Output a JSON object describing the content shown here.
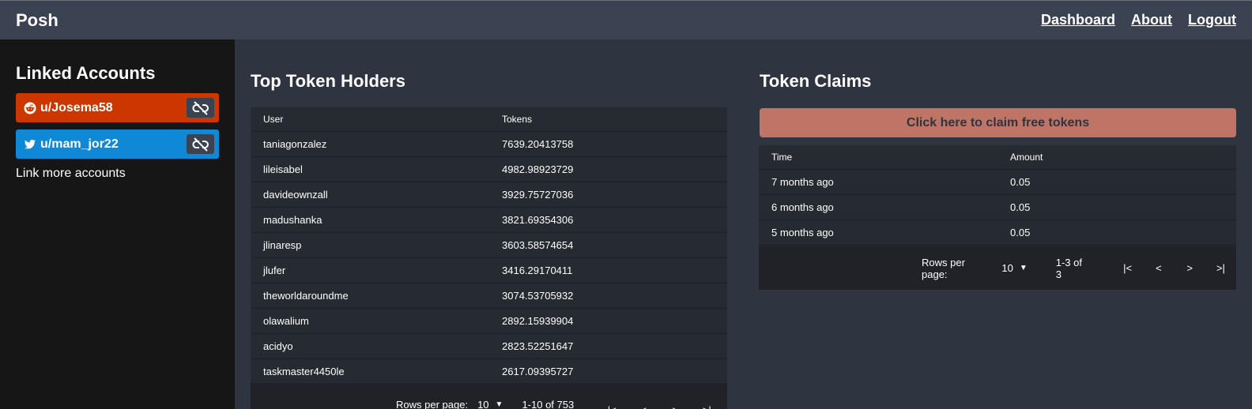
{
  "app": {
    "title": "Posh"
  },
  "nav": {
    "dashboard": "Dashboard",
    "about": "About",
    "logout": "Logout"
  },
  "sidebar": {
    "heading": "Linked Accounts",
    "accounts": [
      {
        "service": "reddit",
        "name": "u/Josema58",
        "color": "#cc3700"
      },
      {
        "service": "twitter",
        "name": "u/mam_jor22",
        "color": "#0f89d6"
      }
    ],
    "link_more": "Link more accounts"
  },
  "holders": {
    "title": "Top Token Holders",
    "columns": [
      "User",
      "Tokens"
    ],
    "rows": [
      [
        "taniagonzalez",
        "7639.20413758"
      ],
      [
        "lileisabel",
        "4982.98923729"
      ],
      [
        "davideownzall",
        "3929.75727036"
      ],
      [
        "madushanka",
        "3821.69354306"
      ],
      [
        "jlinaresp",
        "3603.58574654"
      ],
      [
        "jlufer",
        "3416.29170411"
      ],
      [
        "theworldaroundme",
        "3074.53705932"
      ],
      [
        "olawalium",
        "2892.15939904"
      ],
      [
        "acidyo",
        "2823.52251647"
      ],
      [
        "taskmaster4450le",
        "2617.09395727"
      ]
    ],
    "pager": {
      "rows_label": "Rows per page:",
      "rows_value": "10",
      "range": "1-10 of 753"
    }
  },
  "claims": {
    "title": "Token Claims",
    "claim_button": "Click here to claim free tokens",
    "columns": [
      "Time",
      "Amount"
    ],
    "rows": [
      [
        "7 months ago",
        "0.05"
      ],
      [
        "6 months ago",
        "0.05"
      ],
      [
        "5 months ago",
        "0.05"
      ]
    ],
    "pager": {
      "rows_label": "Rows per page:",
      "rows_value": "10",
      "range": "1-3 of 3"
    }
  },
  "icons": {
    "reddit": "reddit-icon",
    "twitter": "twitter-icon",
    "unlink": "unlink-icon",
    "first": "first-page-icon",
    "prev": "prev-page-icon",
    "next": "next-page-icon",
    "last": "last-page-icon",
    "dropdown": "caret-down-icon"
  },
  "colors": {
    "accent": "#c07465",
    "reddit": "#cc3700",
    "twitter": "#0f89d6"
  }
}
